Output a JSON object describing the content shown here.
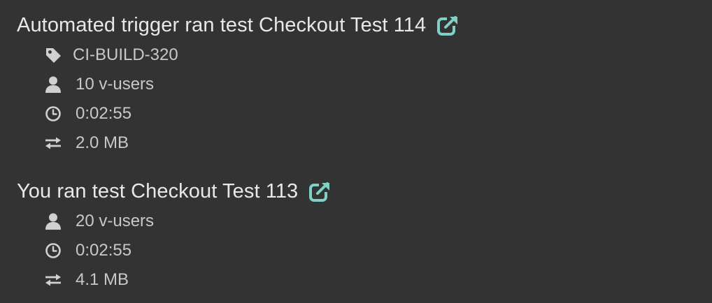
{
  "colors": {
    "background": "#333333",
    "title_text": "#e8e8e8",
    "meta_text": "#c8c8c8",
    "icon": "#d0d0d0",
    "accent": "#7fd1c7"
  },
  "entries": [
    {
      "title": "Automated trigger ran test Checkout Test 114",
      "link_icon": "external-link-icon",
      "tag": {
        "icon": "tag-icon",
        "label": "CI-BUILD-320"
      },
      "users": {
        "icon": "user-icon",
        "label": "10 v-users"
      },
      "duration": {
        "icon": "clock-icon",
        "label": "0:02:55"
      },
      "data": {
        "icon": "transfer-icon",
        "label": "2.0 MB"
      }
    },
    {
      "title": "You ran test Checkout Test 113",
      "link_icon": "external-link-icon",
      "users": {
        "icon": "user-icon",
        "label": "20 v-users"
      },
      "duration": {
        "icon": "clock-icon",
        "label": "0:02:55"
      },
      "data": {
        "icon": "transfer-icon",
        "label": "4.1 MB"
      }
    }
  ]
}
